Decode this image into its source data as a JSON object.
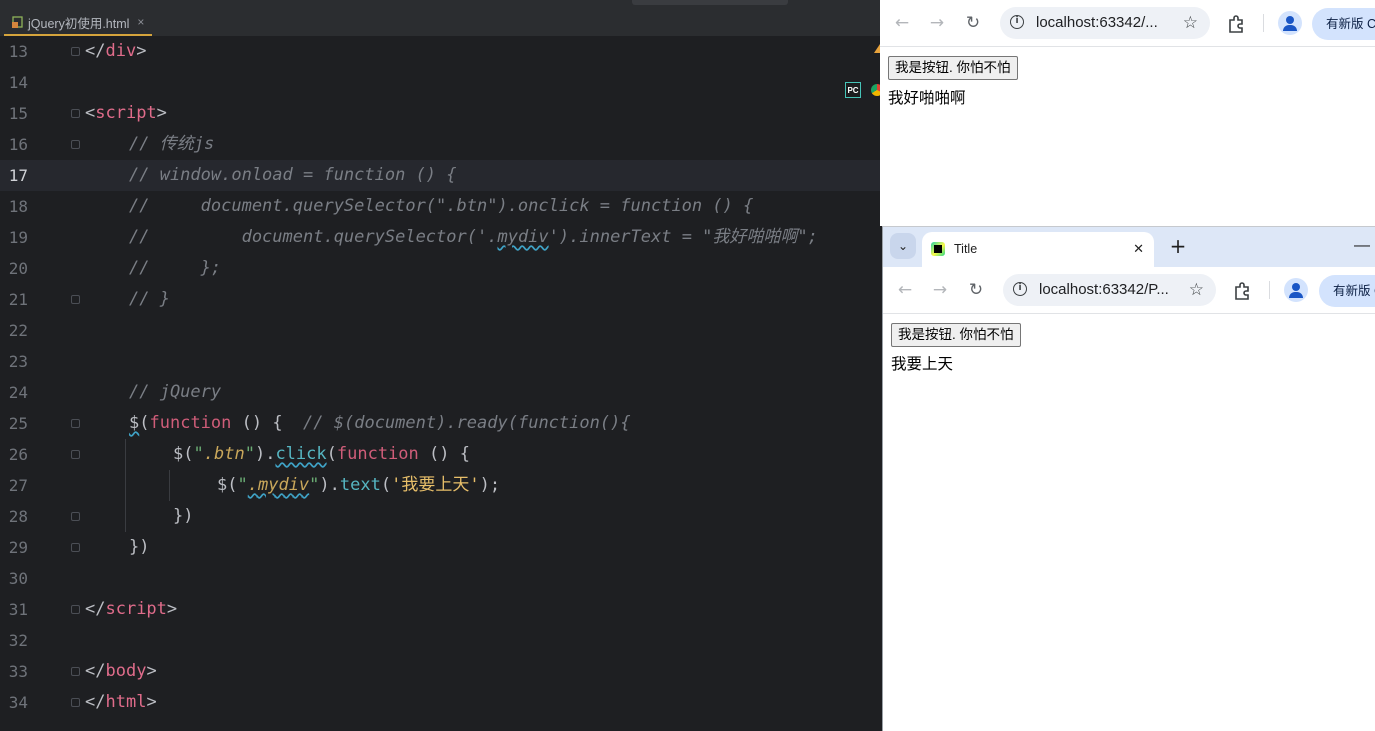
{
  "editor": {
    "tab_label": "jQuery初使用.html",
    "tab_close": "×",
    "pc_badge": "PC",
    "lines": [
      {
        "num": "13",
        "indent": 0,
        "fold": true,
        "tokens": [
          [
            "c-punc",
            "</"
          ],
          [
            "c-tag",
            "div"
          ],
          [
            "c-punc",
            ">"
          ]
        ]
      },
      {
        "num": "14",
        "indent": 0,
        "fold": false,
        "tokens": []
      },
      {
        "num": "15",
        "indent": 0,
        "fold": true,
        "tokens": [
          [
            "c-punc",
            "<"
          ],
          [
            "c-tag",
            "script"
          ],
          [
            "c-punc",
            ">"
          ]
        ]
      },
      {
        "num": "16",
        "indent": 1,
        "fold": true,
        "tokens": [
          [
            "c-com",
            "// 传统js"
          ]
        ]
      },
      {
        "num": "17",
        "indent": 1,
        "fold": false,
        "current": true,
        "tokens": [
          [
            "c-com",
            "// window.onload = function () {"
          ]
        ]
      },
      {
        "num": "18",
        "indent": 1,
        "fold": false,
        "tokens": [
          [
            "c-com",
            "//     document.querySelector(\".btn\").onclick = function () {"
          ]
        ]
      },
      {
        "num": "19",
        "indent": 1,
        "fold": false,
        "tokens": [
          [
            "c-com",
            "//         document.querySelector('."
          ],
          [
            "c-com wavy",
            "mydiv"
          ],
          [
            "c-com",
            "').innerText = \"我好啪啪啊\";"
          ]
        ]
      },
      {
        "num": "20",
        "indent": 1,
        "fold": false,
        "tokens": [
          [
            "c-com",
            "//     };"
          ]
        ]
      },
      {
        "num": "21",
        "indent": 1,
        "fold": true,
        "tokens": [
          [
            "c-com",
            "// }"
          ]
        ]
      },
      {
        "num": "22",
        "indent": 0,
        "fold": false,
        "tokens": []
      },
      {
        "num": "23",
        "indent": 0,
        "fold": false,
        "tokens": []
      },
      {
        "num": "24",
        "indent": 1,
        "fold": false,
        "tokens": [
          [
            "c-com",
            "// jQuery"
          ]
        ]
      },
      {
        "num": "25",
        "indent": 1,
        "fold": true,
        "tokens": [
          [
            "c-id wavy",
            "$"
          ],
          [
            "c-punc",
            "("
          ],
          [
            "c-kw",
            "function"
          ],
          [
            "c-punc",
            " () {  "
          ],
          [
            "c-com",
            "// $(document).ready(function(){"
          ]
        ]
      },
      {
        "num": "26",
        "indent": 2,
        "fold": true,
        "tokens": [
          [
            "c-id",
            "$"
          ],
          [
            "c-punc",
            "("
          ],
          [
            "c-str",
            "\""
          ],
          [
            "c-sel",
            ".btn"
          ],
          [
            "c-str",
            "\""
          ],
          [
            "c-punc",
            ")."
          ],
          [
            "c-fn2 wavy",
            "click"
          ],
          [
            "c-punc",
            "("
          ],
          [
            "c-kw",
            "function"
          ],
          [
            "c-punc",
            " () {"
          ]
        ]
      },
      {
        "num": "27",
        "indent": 3,
        "fold": false,
        "tokens": [
          [
            "c-id",
            "$"
          ],
          [
            "c-punc",
            "("
          ],
          [
            "c-str",
            "\""
          ],
          [
            "c-sel wavy",
            ".mydiv"
          ],
          [
            "c-str",
            "\""
          ],
          [
            "c-punc",
            ")."
          ],
          [
            "c-fn2",
            "text"
          ],
          [
            "c-punc",
            "("
          ],
          [
            "c-zh",
            "'我要上天'"
          ],
          [
            "c-punc",
            ");"
          ]
        ]
      },
      {
        "num": "28",
        "indent": 2,
        "fold": true,
        "tokens": [
          [
            "c-punc",
            "})"
          ]
        ]
      },
      {
        "num": "29",
        "indent": 1,
        "fold": true,
        "tokens": [
          [
            "c-punc",
            "})"
          ]
        ]
      },
      {
        "num": "30",
        "indent": 0,
        "fold": false,
        "tokens": []
      },
      {
        "num": "31",
        "indent": 0,
        "fold": true,
        "tokens": [
          [
            "c-punc",
            "</"
          ],
          [
            "c-tag",
            "script"
          ],
          [
            "c-punc",
            ">"
          ]
        ]
      },
      {
        "num": "32",
        "indent": 0,
        "fold": false,
        "tokens": []
      },
      {
        "num": "33",
        "indent": 0,
        "fold": true,
        "tokens": [
          [
            "c-punc",
            "</"
          ],
          [
            "c-tag",
            "body"
          ],
          [
            "c-punc",
            ">"
          ]
        ]
      },
      {
        "num": "34",
        "indent": 0,
        "fold": true,
        "tokens": [
          [
            "c-punc",
            "</"
          ],
          [
            "c-tag",
            "html"
          ],
          [
            "c-punc",
            ">"
          ]
        ]
      }
    ]
  },
  "browser1": {
    "url": "localhost:63342/...",
    "new_version_label": "有新版 C",
    "page": {
      "button_label": "我是按钮. 你怕不怕",
      "div_text": "我好啪啪啊"
    }
  },
  "browser2": {
    "tab_title": "Title",
    "tab_close": "✕",
    "new_tab": "+",
    "minimize": "—",
    "tab_search": "⌄",
    "url": "localhost:63342/P...",
    "new_version_label": "有新版 C",
    "page": {
      "button_label": "我是按钮. 你怕不怕",
      "div_text": "我要上天"
    }
  },
  "icons": {
    "back": "←",
    "forward": "→",
    "reload": "↻",
    "star": "☆",
    "info": "i"
  }
}
